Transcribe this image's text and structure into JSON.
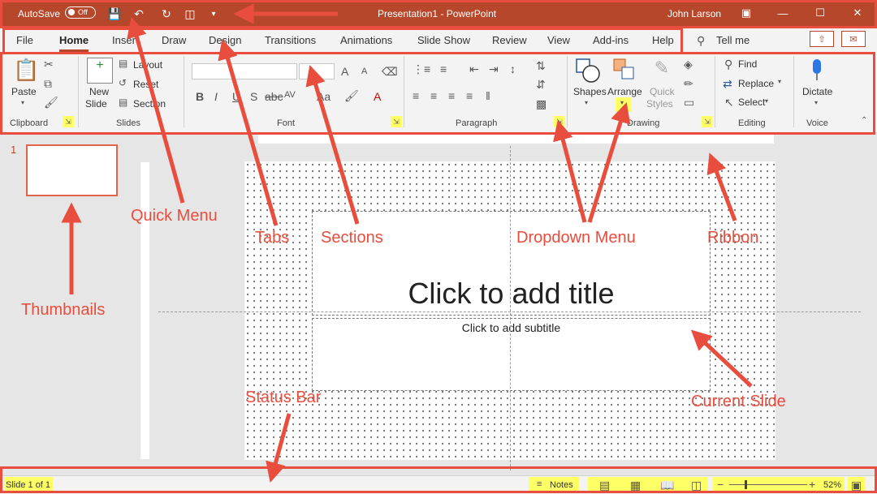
{
  "titlebar": {
    "autosave_label": "AutoSave",
    "autosave_state": "Off",
    "title": "Presentation1  -  PowerPoint",
    "user": "John Larson"
  },
  "tabs": [
    "File",
    "Home",
    "Insert",
    "Draw",
    "Design",
    "Transitions",
    "Animations",
    "Slide Show",
    "Review",
    "View",
    "Add-ins",
    "Help"
  ],
  "active_tab": "Home",
  "tell_me": "Tell me",
  "ribbon": {
    "clipboard": {
      "paste": "Paste",
      "group": "Clipboard"
    },
    "slides": {
      "new_slide_1": "New",
      "new_slide_2": "Slide",
      "layout": "Layout",
      "reset": "Reset",
      "section": "Section",
      "group": "Slides"
    },
    "font": {
      "group": "Font"
    },
    "paragraph": {
      "group": "Paragraph"
    },
    "drawing": {
      "shapes": "Shapes",
      "arrange": "Arrange",
      "quick_styles_1": "Quick",
      "quick_styles_2": "Styles",
      "group": "Drawing"
    },
    "editing": {
      "find": "Find",
      "replace": "Replace",
      "select": "Select",
      "group": "Editing"
    },
    "voice": {
      "dictate": "Dictate",
      "group": "Voice"
    }
  },
  "thumbnail_number": "1",
  "slide": {
    "title_placeholder": "Click to add title",
    "subtitle_placeholder": "Click to add subtitle"
  },
  "statusbar": {
    "slide_count": "Slide 1 of 1",
    "notes": "Notes",
    "zoom": "52%"
  },
  "annotations": {
    "quick_menu": "Quick Menu",
    "tabs": "Tabs",
    "sections": "Sections",
    "dropdown_menu": "Dropdown Menu",
    "ribbon": "Ribbon",
    "thumbnails": "Thumbnails",
    "status_bar": "Status Bar",
    "current_slide": "Current Slide"
  },
  "colors": {
    "accent": "#b7472a",
    "annotation": "#e84d3d",
    "highlight": "#ffff66"
  }
}
